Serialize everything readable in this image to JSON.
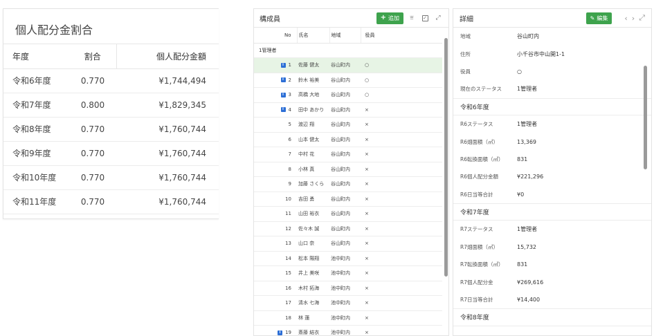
{
  "share": {
    "title": "個人配分金割合",
    "headers": [
      "年度",
      "割合",
      "個人配分金額"
    ],
    "rows": [
      {
        "year": "令和6年度",
        "ratio": "0.770",
        "amount": "¥1,744,494"
      },
      {
        "year": "令和7年度",
        "ratio": "0.800",
        "amount": "¥1,829,345"
      },
      {
        "year": "令和8年度",
        "ratio": "0.770",
        "amount": "¥1,760,744"
      },
      {
        "year": "令和9年度",
        "ratio": "0.770",
        "amount": "¥1,760,744"
      },
      {
        "year": "令和10年度",
        "ratio": "0.770",
        "amount": "¥1,760,744"
      },
      {
        "year": "令和11年度",
        "ratio": "0.770",
        "amount": "¥1,760,744"
      }
    ]
  },
  "members": {
    "title": "構成員",
    "add_label": "追加",
    "icons": {
      "filter": "filter-icon",
      "check": "checkbox-icon",
      "expand": "expand-icon"
    },
    "headers": [
      "No",
      "氏名",
      "地域",
      "役員"
    ],
    "group_label": "1管理者",
    "rows": [
      {
        "no": "1",
        "name": "佐藤 健太",
        "area": "谷山町内",
        "role": "○",
        "badge": true,
        "selected": true
      },
      {
        "no": "2",
        "name": "鈴木 裕美",
        "area": "谷山町内",
        "role": "○",
        "badge": true
      },
      {
        "no": "3",
        "name": "高橋 大地",
        "area": "谷山町内",
        "role": "○",
        "badge": true
      },
      {
        "no": "4",
        "name": "田中 あかり",
        "area": "谷山町内",
        "role": "×",
        "badge": true
      },
      {
        "no": "5",
        "name": "渡辺 翔",
        "area": "谷山町内",
        "role": "×"
      },
      {
        "no": "6",
        "name": "山本 健太",
        "area": "谷山町内",
        "role": "×"
      },
      {
        "no": "7",
        "name": "中村 花",
        "area": "谷山町内",
        "role": "×"
      },
      {
        "no": "8",
        "name": "小林 真",
        "area": "谷山町内",
        "role": "×"
      },
      {
        "no": "9",
        "name": "加藤 さくら",
        "area": "谷山町内",
        "role": "×"
      },
      {
        "no": "10",
        "name": "吉田 勇",
        "area": "谷山町内",
        "role": "×"
      },
      {
        "no": "11",
        "name": "山田 裕衣",
        "area": "谷山町内",
        "role": "×"
      },
      {
        "no": "12",
        "name": "佐々木 誠",
        "area": "谷山町内",
        "role": "×"
      },
      {
        "no": "13",
        "name": "山口 奈",
        "area": "谷山町内",
        "role": "×"
      },
      {
        "no": "14",
        "name": "松本 陽翔",
        "area": "池中町内",
        "role": "×"
      },
      {
        "no": "15",
        "name": "井上 美咲",
        "area": "池中町内",
        "role": "×"
      },
      {
        "no": "16",
        "name": "木村 拓海",
        "area": "池中町内",
        "role": "×"
      },
      {
        "no": "17",
        "name": "清水 七海",
        "area": "池中町内",
        "role": "×"
      },
      {
        "no": "18",
        "name": "林 蓮",
        "area": "池中町内",
        "role": "×"
      },
      {
        "no": "19",
        "name": "斎藤 結衣",
        "area": "池中町内",
        "role": "×",
        "badge": true
      }
    ]
  },
  "detail": {
    "title": "詳細",
    "edit_label": "編集",
    "icons": {
      "edit": "edit-icon",
      "prev": "chevron-left-icon",
      "next": "chevron-right-icon"
    },
    "top_rows": [
      {
        "k": "地域",
        "v": "谷山町内"
      },
      {
        "k": "住所",
        "v": "小千谷市中山開1-1"
      },
      {
        "k": "役員",
        "v": "○"
      },
      {
        "k": "現在のステータス",
        "v": "1管理者"
      }
    ],
    "sections": [
      {
        "title": "令和6年度",
        "rows": [
          {
            "k": "R6ステータス",
            "v": "1管理者"
          },
          {
            "k": "R6畑面積（㎡）",
            "v": "13,369"
          },
          {
            "k": "R6転換面積（㎡）",
            "v": "831"
          },
          {
            "k": "R6個人配分金額",
            "v": "¥221,296"
          },
          {
            "k": "R6日当等合計",
            "v": "¥0"
          }
        ]
      },
      {
        "title": "令和7年度",
        "rows": [
          {
            "k": "R7ステータス",
            "v": "1管理者"
          },
          {
            "k": "R7畑面積（㎡）",
            "v": "15,732"
          },
          {
            "k": "R7転換面積（㎡）",
            "v": "831"
          },
          {
            "k": "R7個人配分金",
            "v": "¥269,616"
          },
          {
            "k": "R7日当等合計",
            "v": "¥14,400"
          }
        ]
      },
      {
        "title": "令和8年度",
        "rows": []
      }
    ]
  },
  "colors": {
    "accent": "#3ea34d",
    "selected_row": "#e7f4e5",
    "badge": "#2d6fd6"
  }
}
